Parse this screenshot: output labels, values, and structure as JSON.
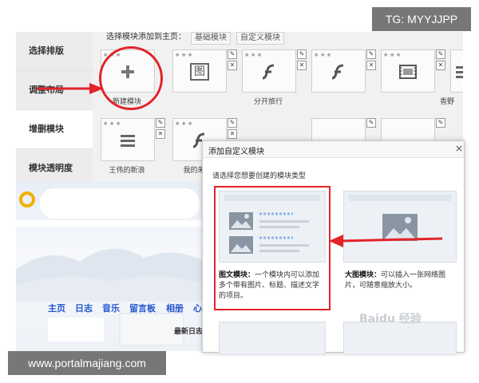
{
  "corner_tag": "TG: MYYJJPP",
  "footer_url": "www.portalmajiang.com",
  "watermark": "Baidu 经验",
  "sidebar": {
    "items": [
      {
        "label": "选择排版"
      },
      {
        "label": "调整布局"
      },
      {
        "label": "增删模块"
      },
      {
        "label": "模块透明度"
      }
    ]
  },
  "module_bar": {
    "title": "选择模块添加到主页：",
    "tabs": [
      {
        "label": "基础模块"
      },
      {
        "label": "自定义模块"
      }
    ]
  },
  "modules": {
    "row1": [
      {
        "label": "新建模块",
        "icon": "plus-icon"
      },
      {
        "label": "",
        "icon": "image-char-icon"
      },
      {
        "label": "分开旅行",
        "icon": "flash-icon"
      },
      {
        "label": "",
        "icon": "flash-icon"
      },
      {
        "label": "",
        "icon": "film-icon"
      },
      {
        "label": "香野",
        "icon": "list-icon"
      }
    ],
    "row2": [
      {
        "label": "王伟的新浪",
        "icon": "list-icon"
      },
      {
        "label": "我的朱",
        "icon": "flash-icon"
      }
    ],
    "image_glyph": "图"
  },
  "blog": {
    "nav": [
      "主页",
      "日志",
      "音乐",
      "留言板",
      "相册",
      "心"
    ],
    "section_title": "最新日志"
  },
  "dialog": {
    "title": "添加自定义模块",
    "close": "×",
    "prompt": "请选择您想要创建的模块类型",
    "cards": [
      {
        "title": "图文模块：",
        "desc": "一个模块内可以添加多个带有图片、标题、描述文字的项目。"
      },
      {
        "title": "大图模块：",
        "desc": "可以插入一张网络图片，可随意缩放大小。"
      }
    ]
  },
  "colors": {
    "highlight_red": "#e2232a",
    "link_blue": "#2255cc"
  }
}
